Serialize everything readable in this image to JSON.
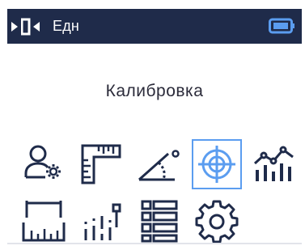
{
  "status_bar": {
    "label": "Едн",
    "unit_icon": "reference-edge-icon",
    "battery_icon": "battery-icon"
  },
  "screen": {
    "title": "Калибровка"
  },
  "menu": {
    "selected": "target-icon",
    "rows": [
      [
        "user-settings-icon",
        "ruler-icon",
        "angle-icon",
        "target-icon",
        "chart-icon"
      ],
      [
        "measurement-icon",
        "bars-dot-icon",
        "list-icon",
        "gear-icon"
      ]
    ]
  },
  "colors": {
    "header_bg": "#1f2b4a",
    "icon": "#1f2b4a",
    "selected": "#5b9df0",
    "battery": "#5b9df0",
    "title": "#2b2b3a"
  }
}
